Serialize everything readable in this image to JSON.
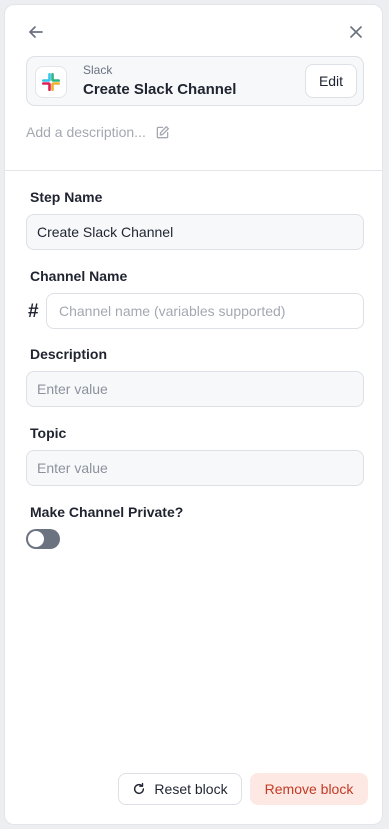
{
  "header": {
    "back_icon": "arrow-left-icon",
    "close_icon": "close-icon"
  },
  "app_card": {
    "app_name": "Slack",
    "step_title": "Create Slack Channel",
    "edit_label": "Edit",
    "logo_icon": "slack-logo-icon"
  },
  "description_line": {
    "placeholder": "Add a description...",
    "icon": "edit-pencil-icon"
  },
  "form": {
    "step_name": {
      "label": "Step Name",
      "value": "Create Slack Channel"
    },
    "channel_name": {
      "label": "Channel Name",
      "prefix": "#",
      "placeholder": "Channel name (variables supported)"
    },
    "description": {
      "label": "Description",
      "placeholder": "Enter value"
    },
    "topic": {
      "label": "Topic",
      "placeholder": "Enter value"
    },
    "make_private": {
      "label": "Make Channel Private?",
      "checked": false
    }
  },
  "footer": {
    "reset_label": "Reset block",
    "reset_icon": "refresh-icon",
    "remove_label": "Remove block"
  },
  "colors": {
    "remove_text": "#c43a24",
    "remove_bg": "#fde8e4",
    "toggle_off": "#6b7280"
  }
}
